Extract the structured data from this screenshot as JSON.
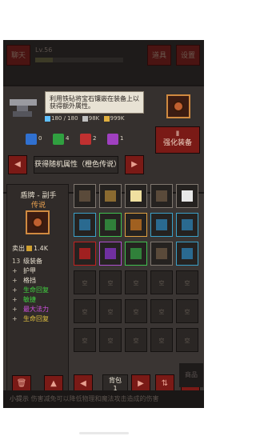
{
  "header": {
    "chat_label": "聊天",
    "level_text": "Lv.56",
    "level_progress": 0.2,
    "props_label": "道具",
    "settings_label": "设置"
  },
  "forge": {
    "hint_text": "利用铁砧将宝石镶嵌在装备上以获得额外属性。",
    "costs": [
      {
        "value": "180 / 180",
        "color": "#60c0ff"
      },
      {
        "value": "98K",
        "color": "#c0c0c0"
      },
      {
        "value": "999K",
        "color": "#e0b040"
      }
    ],
    "runes": [
      {
        "count": "0",
        "color": "#3070d0"
      },
      {
        "count": "4",
        "color": "#30a040"
      },
      {
        "count": "2",
        "color": "#c03030"
      },
      {
        "count": "1",
        "color": "#a040c0"
      }
    ],
    "random_attr_label": "获得随机属性（橙色传说）",
    "enhance_label_line1": "强化装备",
    "enhance_label_roman": "Ⅱ"
  },
  "item_info": {
    "title": "盾牌 - 副手",
    "rarity": "传说",
    "score_label": "卖出",
    "score_value": "1.4K",
    "stats": [
      {
        "num": "13",
        "name": "级装备",
        "color": "#e8e0d0"
      },
      {
        "num": "+",
        "name": "护甲",
        "color": "#e8e0d0"
      },
      {
        "num": "+",
        "name": "格挡",
        "color": "#e8e0d0"
      },
      {
        "num": "+",
        "name": "生命回复",
        "color": "#40d040"
      },
      {
        "num": "+",
        "name": "敏捷",
        "color": "#40d040"
      },
      {
        "num": "+",
        "name": "最大法力",
        "color": "#d050e0"
      },
      {
        "num": "+",
        "name": "生命回复",
        "color": "#e0c040"
      }
    ]
  },
  "inventory": {
    "empty_label": "空",
    "bag_label": "背包",
    "bag_page": "1"
  },
  "tips": {
    "label": "小提示",
    "text": "伤害减免可以降低物理和魔法攻击造成的伤害"
  },
  "shop_label": "商品"
}
